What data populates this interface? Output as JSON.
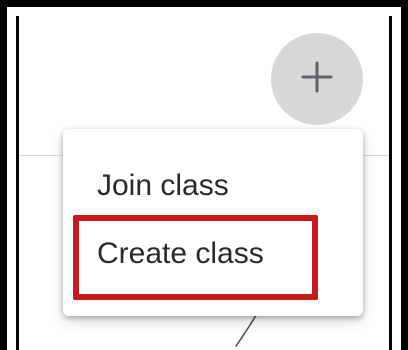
{
  "header": {
    "add_button": {
      "icon": "plus-icon"
    }
  },
  "menu": {
    "items": [
      {
        "label": "Join class"
      },
      {
        "label": "Create class"
      }
    ]
  },
  "annotation": {
    "highlight_color": "#c71a1a"
  },
  "colors": {
    "menu_text": "#2a2a2a",
    "plus_button_bg": "#d7d7d7",
    "divider": "#d9d9d9"
  }
}
